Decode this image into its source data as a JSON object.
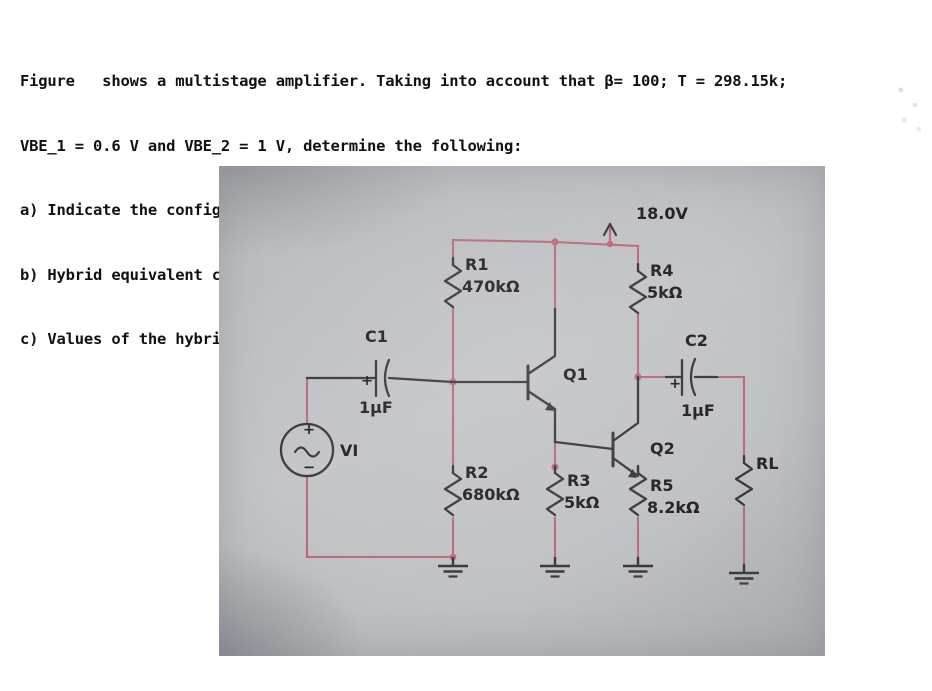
{
  "problem": {
    "lines": [
      "Figure   shows a multistage amplifier. Taking into account that β= 100; T = 298.15k;",
      "VBE_1 = 0.6 V and VBE_2 = 1 V, determine the following:",
      "a) Indicate the configuration of each stage, justifying your answer",
      "b) Hybrid equivalent circuit of the entire circuit",
      "c) Values of the hybrid parameters hi and hf"
    ]
  },
  "circuit": {
    "supply_label": "18.0V",
    "source_label": "VI",
    "source_plus": "+",
    "source_minus": "−",
    "components": {
      "c1": {
        "ref": "C1",
        "value": "1µF",
        "polarity": "+"
      },
      "c2": {
        "ref": "C2",
        "value": "1µF",
        "polarity": "+"
      },
      "r1": {
        "ref": "R1",
        "value": "470kΩ"
      },
      "r2": {
        "ref": "R2",
        "value": "680kΩ"
      },
      "r3": {
        "ref": "R3",
        "value": "5kΩ"
      },
      "r4": {
        "ref": "R4",
        "value": "5kΩ"
      },
      "r5": {
        "ref": "R5",
        "value": "8.2kΩ"
      },
      "rl": {
        "ref": "RL",
        "value": ""
      },
      "q1": {
        "ref": "Q1"
      },
      "q2": {
        "ref": "Q2"
      }
    },
    "colors": {
      "wire": "#c0687e",
      "device": "#3a3a3e",
      "label": "#242428",
      "photo_bg": "#bfc1c4"
    }
  }
}
